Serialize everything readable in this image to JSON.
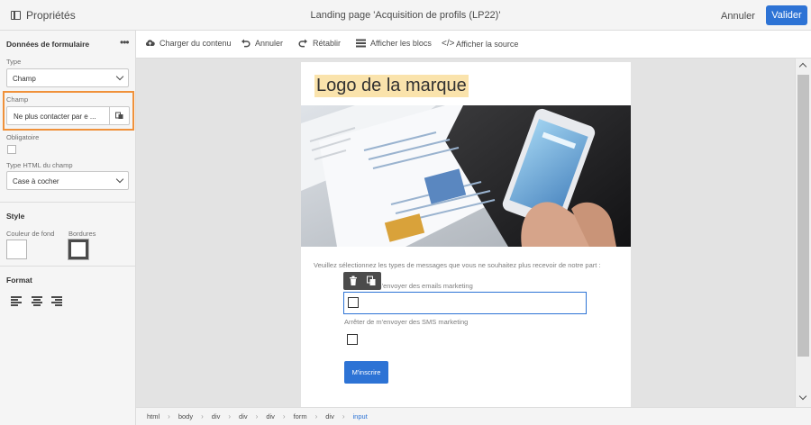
{
  "topbar": {
    "panel_title": "Propriétés",
    "page_title": "Landing page 'Acquisition de profils (LP22)'",
    "cancel_label": "Annuler",
    "validate_label": "Valider"
  },
  "left_panel": {
    "section_form": "Données de formulaire",
    "type_label": "Type",
    "type_value": "Champ",
    "field_label": "Champ",
    "field_value": "Ne plus contacter par e ...",
    "required_label": "Obligatoire",
    "html_type_label": "Type HTML du champ",
    "html_type_value": "Case à cocher",
    "section_style": "Style",
    "bg_color_label": "Couleur de fond",
    "borders_label": "Bordures",
    "section_format": "Format"
  },
  "toolbar": {
    "load_content": "Charger du contenu",
    "undo": "Annuler",
    "redo": "Rétablir",
    "show_blocks": "Afficher les blocs",
    "show_source": "Afficher la source"
  },
  "document": {
    "logo_text": "Logo de la marque",
    "intro": "Veuillez sélectionnez les types de messages que vous ne souhaitez plus recevoir de notre part :",
    "option1": "Arrêter de m'envoyer des emails marketing",
    "option2": "Arrêter de m'envoyer des SMS marketing",
    "submit_label": "M'inscrire"
  },
  "breadcrumb": [
    "html",
    "body",
    "div",
    "div",
    "div",
    "form",
    "div",
    "input"
  ],
  "colors": {
    "accent": "#2d73d5",
    "highlight_border": "#f0913a",
    "logo_bg": "#fae3ac"
  }
}
